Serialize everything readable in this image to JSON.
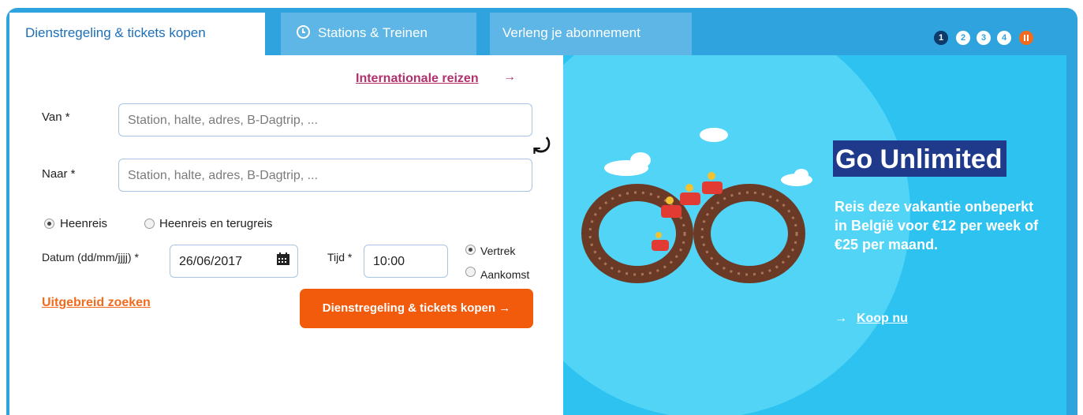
{
  "tabs": [
    {
      "label": "Dienstregeling & tickets kopen",
      "active": true
    },
    {
      "label": "Stations & Treinen",
      "icon": "clock-icon"
    },
    {
      "label": "Verleng je abonnement"
    }
  ],
  "slider": {
    "dots": [
      "1",
      "2",
      "3",
      "4"
    ],
    "active": "1",
    "pause_icon": "pause-icon"
  },
  "search": {
    "international_link": "Internationale reizen",
    "from_label": "Van *",
    "from_placeholder": "Station, halte, adres, B-Dagtrip, ...",
    "to_label": "Naar *",
    "to_placeholder": "Station, halte, adres, B-Dagtrip, ...",
    "trip_type": {
      "options": [
        "Heenreis",
        "Heenreis en terugreis"
      ],
      "selected": "Heenreis"
    },
    "date_label": "Datum (dd/mm/jjjj) *",
    "date_value": "26/06/2017",
    "time_label": "Tijd *",
    "time_value": "10:00",
    "time_mode": {
      "options": [
        "Vertrek",
        "Aankomst"
      ],
      "selected": "Vertrek"
    },
    "advanced_link": "Uitgebreid zoeken",
    "submit_label": "Dienstregeling & tickets kopen"
  },
  "promo": {
    "title": "Go Unlimited",
    "text": "Reis deze vakantie onbeperkt in België voor €12 per week of €25 per maand.",
    "cta": "Koop nu"
  },
  "colors": {
    "brand_blue": "#2ea3de",
    "tab_inactive": "#5db6e6",
    "orange": "#f25a0c",
    "link_purple": "#b0306d",
    "promo_bg": "#2dc2f0",
    "title_bg": "#1f3a8a"
  }
}
